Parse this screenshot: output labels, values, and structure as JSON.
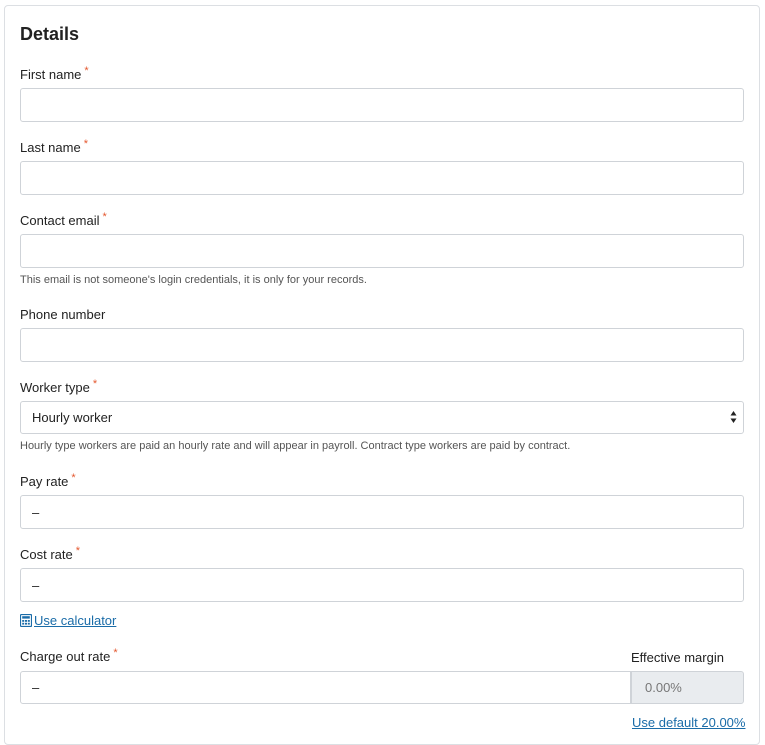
{
  "section": {
    "title": "Details"
  },
  "required_marker": "*",
  "fields": {
    "first_name": {
      "label": "First name",
      "value": ""
    },
    "last_name": {
      "label": "Last name",
      "value": ""
    },
    "contact_email": {
      "label": "Contact email",
      "value": "",
      "help": "This email is not someone's login credentials, it is only for your records."
    },
    "phone_number": {
      "label": "Phone number",
      "value": ""
    },
    "worker_type": {
      "label": "Worker type",
      "value": "Hourly worker",
      "help": "Hourly type workers are paid an hourly rate and will appear in payroll. Contract type workers are paid by contract."
    },
    "pay_rate": {
      "label": "Pay rate",
      "value": "–"
    },
    "cost_rate": {
      "label": "Cost rate",
      "value": "–"
    },
    "charge_out_rate": {
      "label": "Charge out rate",
      "value": "–"
    },
    "effective_margin": {
      "label": "Effective margin",
      "value": "0.00%"
    }
  },
  "links": {
    "use_calculator": "Use calculator",
    "use_default": "Use default 20.00%"
  },
  "icons": {
    "calculator": "calculator-icon",
    "select_arrows": "updown-arrows-icon"
  },
  "colors": {
    "required": "#e4572e",
    "link": "#1a6ca8",
    "readonly_bg": "#e9ecef"
  }
}
